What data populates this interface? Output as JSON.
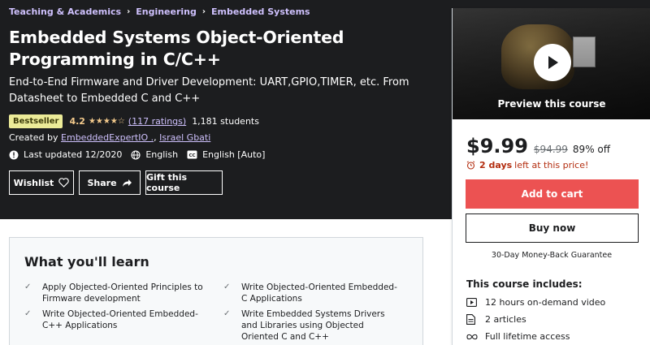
{
  "breadcrumb": {
    "items": [
      "Teaching & Academics",
      "Engineering",
      "Embedded Systems"
    ],
    "separator": "›"
  },
  "course": {
    "title": "Embedded Systems Object-Oriented Programming in C/C++",
    "subtitle": "End-to-End Firmware and Driver Development: UART,GPIO,TIMER, etc. From Datasheet to Embedded C and C++",
    "badge": "Bestseller",
    "rating": "4.2",
    "stars": "★★★★☆",
    "ratings_count": "(117 ratings)",
    "students": "1,181 students",
    "created_by_label": "Created by",
    "instructors": [
      "EmbeddedExpertIO .",
      "Israel Gbati"
    ],
    "instructor_sep": ",",
    "last_updated": "Last updated 12/2020",
    "language": "English",
    "captions": "English [Auto]"
  },
  "actions": {
    "wishlist": "Wishlist",
    "share": "Share",
    "gift": "Gift this course"
  },
  "learn": {
    "heading": "What you'll learn",
    "items": [
      "Apply Objected-Oriented Principles to Firmware development",
      "Write Objected-Oriented Embedded-C Applications",
      "Write Objected-Oriented Embedded-C++ Applications",
      "Write Embedded Systems Drivers and Libraries using Objected Oriented C and C++"
    ]
  },
  "sidebar": {
    "preview_label": "Preview this course",
    "price": "$9.99",
    "original_price": "$94.99",
    "discount": "89% off",
    "timer_bold": "2 days",
    "timer_rest": "left at this price!",
    "add_to_cart": "Add to cart",
    "buy_now": "Buy now",
    "guarantee": "30-Day Money-Back Guarantee",
    "includes_title": "This course includes:",
    "includes": [
      {
        "icon": "video-icon",
        "label": "12 hours on-demand video"
      },
      {
        "icon": "article-icon",
        "label": "2 articles"
      },
      {
        "icon": "infinity-icon",
        "label": "Full lifetime access"
      }
    ]
  },
  "colors": {
    "hero_bg": "#1c1d1f",
    "link_purple": "#cec0fc",
    "star_gold": "#f3ca8c",
    "badge_bg": "#eceb98",
    "cart_red": "#ec5252",
    "timer_red": "#b32d0f"
  }
}
